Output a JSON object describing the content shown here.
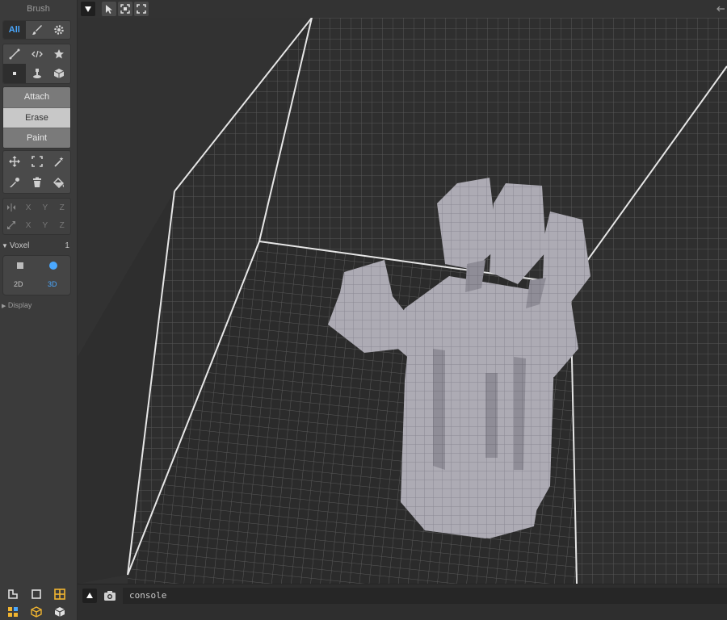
{
  "sidebar": {
    "title": "Brush",
    "tabs": {
      "all": "All",
      "brush_icon": "brush-icon",
      "gear_icon": "gear-icon"
    },
    "modes": [
      "Attach",
      "Erase",
      "Paint"
    ],
    "selected_mode": "Erase",
    "axis_labels": [
      "X",
      "Y",
      "Z"
    ],
    "voxel_label": "Voxel",
    "voxel_value": "1",
    "dim_2d": "2D",
    "dim_3d": "3D",
    "display_label": "Display"
  },
  "console": {
    "placeholder": "console"
  },
  "colors": {
    "accent": "#4aa8ff",
    "voxel": "#a9a7b0",
    "grid_line": "#5a5a5a",
    "edge": "#e6e6e6",
    "icon_yellow": "#f0b430"
  }
}
